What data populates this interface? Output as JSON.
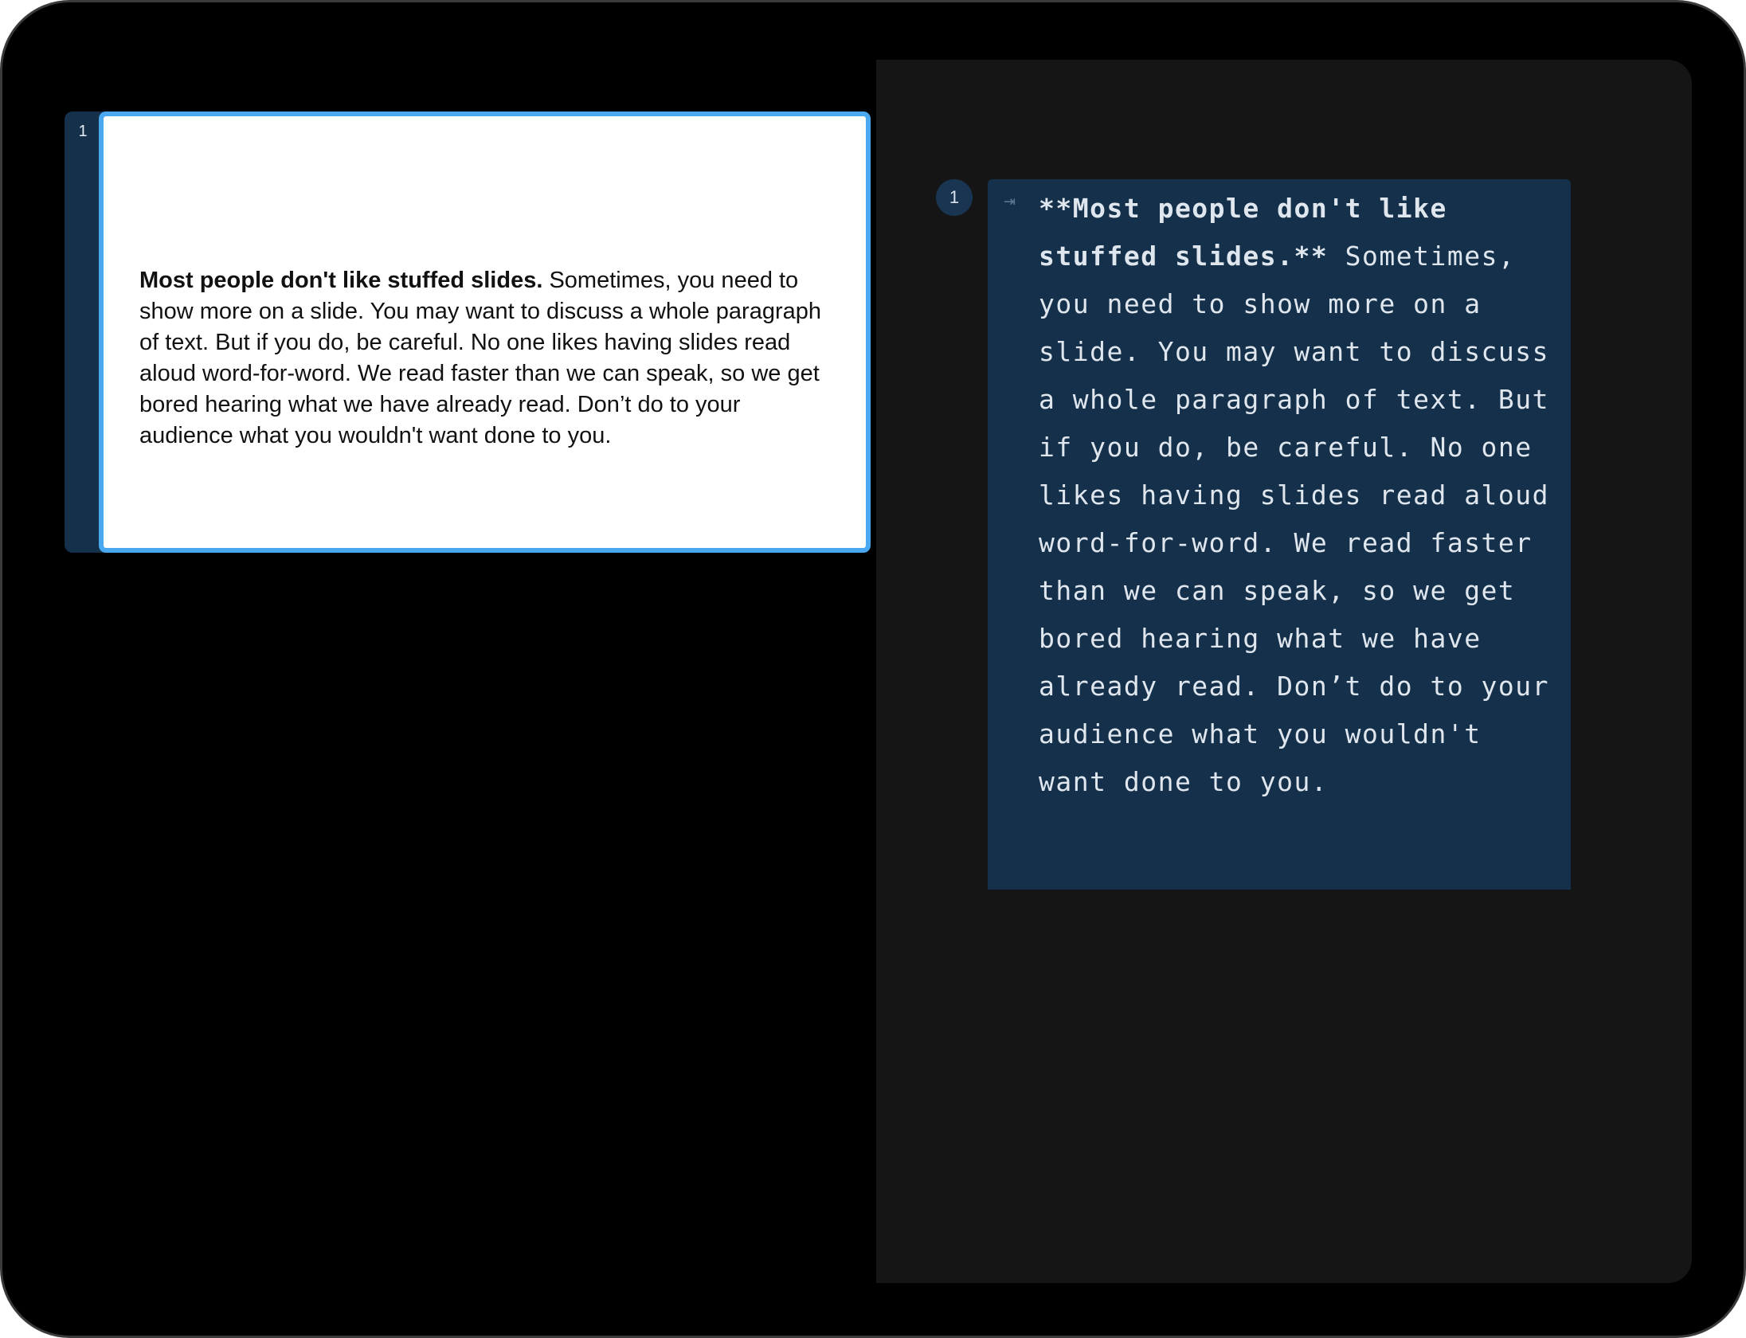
{
  "navigator": {
    "slides": [
      {
        "number": "1",
        "bold_text": "Most people don't like stuffed slides.",
        "body_text": " Sometimes, you need to show more on a slide. You may want to discuss a whole paragraph of text. But if you do, be careful. No one likes having slides read aloud word-for-word. We read faster than we can speak, so we get bored hearing what we have already read. Don’t do to your audience what you wouldn't want done to you."
      }
    ],
    "selected_border_color": "#4aa8f0"
  },
  "editor": {
    "blocks": [
      {
        "number": "1",
        "indent_icon": "indent-icon",
        "markdown_bold": "**Most people don't like stuffed slides.**",
        "markdown_body": " Sometimes, you need to show more on a slide. You may want to discuss a whole paragraph of text. But if you do, be careful. No one likes having slides read aloud word-for-word. We read faster than we can speak, so we get bored hearing what we have already read. Don’t do to your audience what you wouldn't want done to you."
      }
    ],
    "block_background": "#15304a"
  }
}
